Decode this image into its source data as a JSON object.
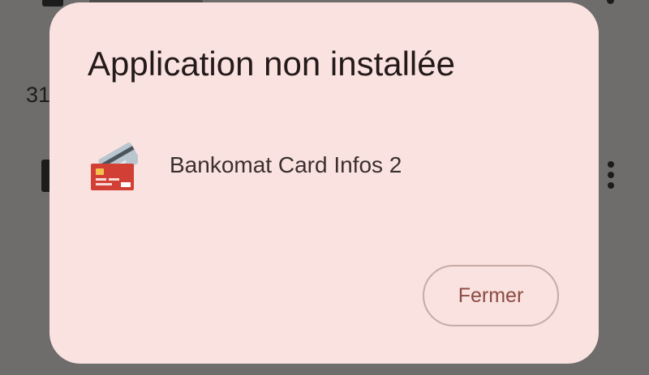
{
  "background": {
    "list_number": "31",
    "more_icon": "more-vert-icon"
  },
  "dialog": {
    "title": "Application non installée",
    "app": {
      "name": "Bankomat Card Infos 2",
      "icon": "credit-card-icon"
    },
    "close_label": "Fermer"
  },
  "colors": {
    "scrim": "#6f6c6c",
    "dialog_background": "#f9e2df",
    "title_text": "#231a19",
    "body_text": "#3a302f",
    "button_text": "#8c4a43",
    "button_border": "#c8aaa6",
    "card_red": "#d23f35",
    "card_silver": "#b9c6cf"
  }
}
